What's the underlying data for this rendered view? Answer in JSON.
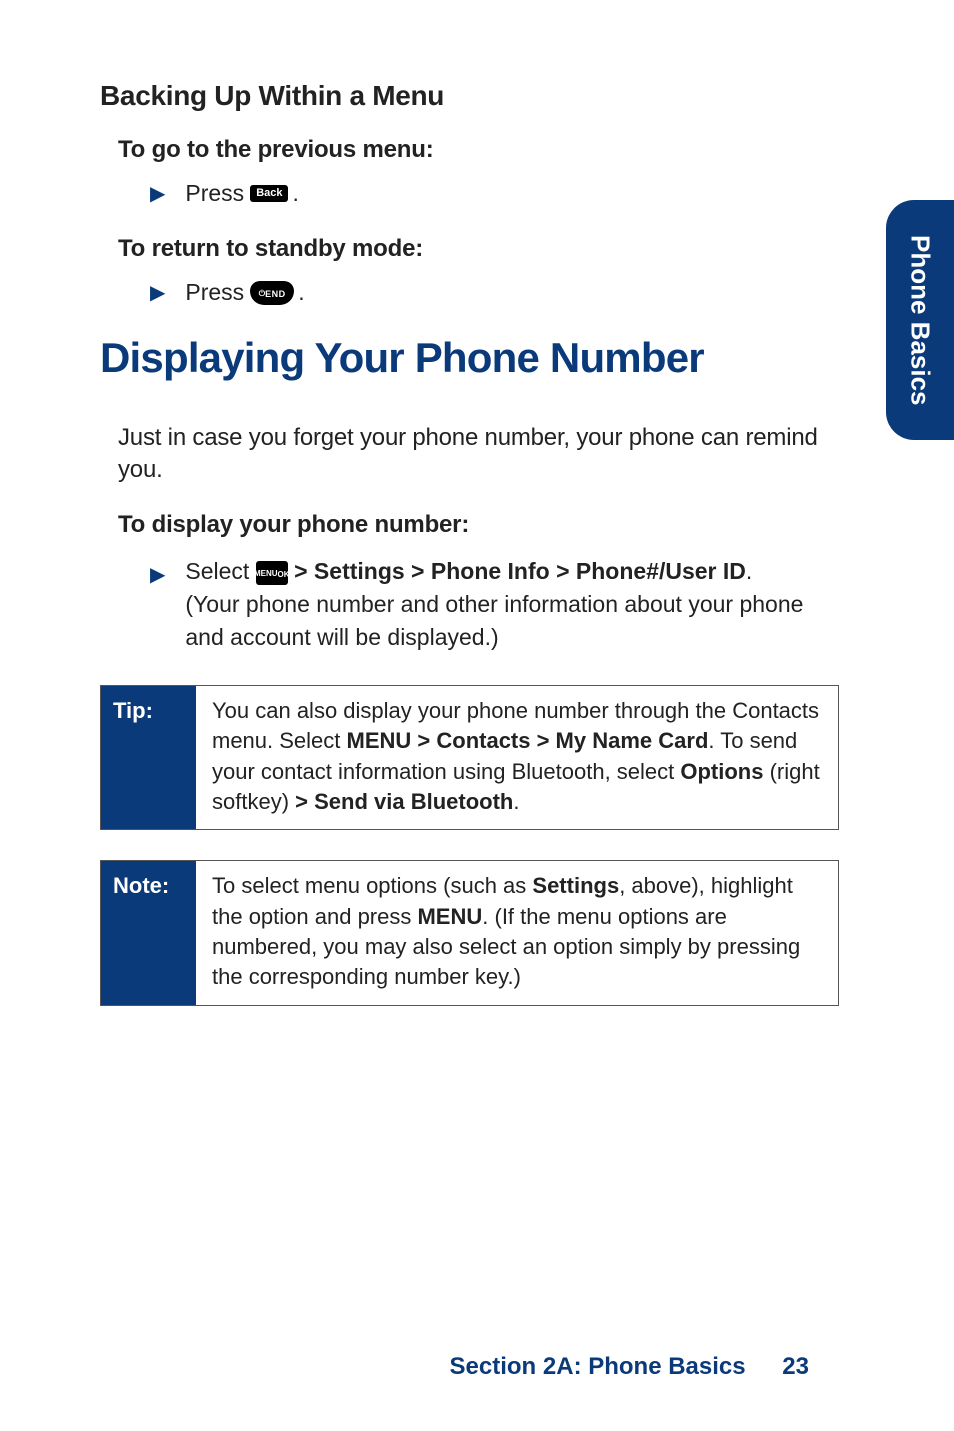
{
  "section": {
    "subheading": "Backing Up Within a Menu",
    "prev_menu_label": "To go to the previous menu:",
    "press_text": "Press",
    "period": ".",
    "standby_label": "To return to standby mode:",
    "main_heading": "Displaying Your Phone Number",
    "intro_text": "Just in case you forget your phone number, your phone can remind you.",
    "display_label": "To display your phone number:",
    "select": {
      "select_word": "Select",
      "path": " > Settings > Phone Info > Phone#/User ID",
      "after": ". (Your phone number and other information about your phone and account will be displayed.)"
    },
    "tip": {
      "label": "Tip:",
      "t1": "You can also display your phone number through the Contacts menu. Select ",
      "b1": "MENU > Contacts > My Name Card",
      "t2": ". To send your contact information using Bluetooth, select ",
      "b2": "Options",
      "t3": " (right softkey) ",
      "b3": "> Send via Bluetooth",
      "t4": "."
    },
    "note": {
      "label": "Note:",
      "t1": "To select menu options (such as ",
      "b1": "Settings",
      "t2": ", above), highlight the option and press ",
      "b2": "MENU",
      "t3": ". (If the menu options are numbered, you may also select an option simply by pressing the corresponding number key.)"
    }
  },
  "icons": {
    "back_label": "Back",
    "end_pwr": "⏻",
    "end_label": "END",
    "menu_l1": "MENU",
    "menu_l2": "OK"
  },
  "side_tab": "Phone Basics",
  "footer": {
    "section_label": "Section 2A: Phone Basics",
    "page_number": "23"
  }
}
